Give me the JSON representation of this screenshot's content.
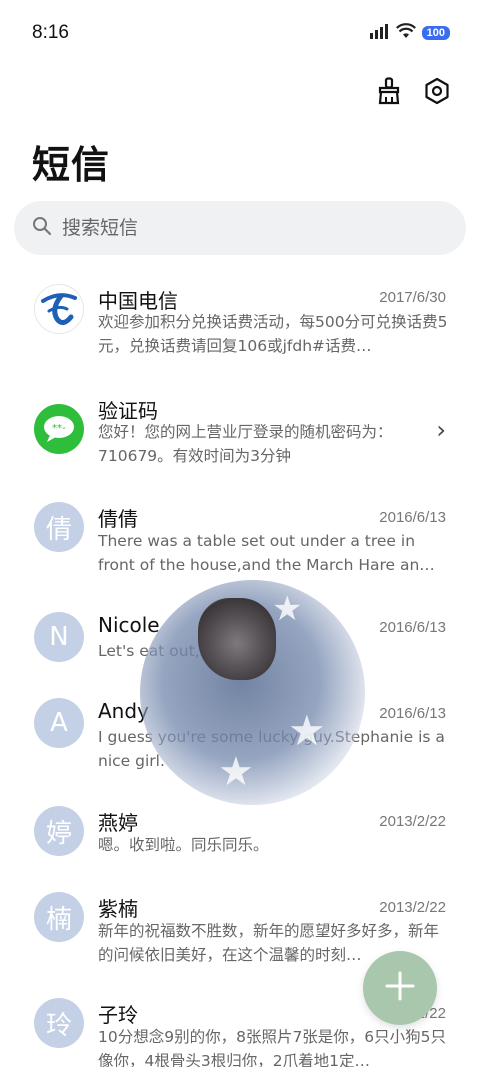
{
  "status_bar": {
    "time": "8:16",
    "battery": "100"
  },
  "header": {
    "title": "短信"
  },
  "search": {
    "placeholder": "搜索短信"
  },
  "messages": [
    {
      "name": "中国电信",
      "date": "2017/6/30",
      "preview": "欢迎参加积分兑换话费活动，每500分可兑换话费5元，兑换话费请回复106或jfdh#话费…",
      "avatar": "telecom-logo"
    },
    {
      "name": "验证码",
      "date": "",
      "preview": "您好！您的网上营业厅登录的随机密码为：710679。有效时间为3分钟",
      "avatar": "message-bubble-icon"
    },
    {
      "name": "倩倩",
      "date": "2016/6/13",
      "preview": "There was a table set out under a tree in front of the house,and the March Hare an…",
      "avatar_text": "倩"
    },
    {
      "name": "Nicole",
      "date": "2016/6/13",
      "preview": "Let's eat out,shall we?",
      "avatar_text": "N"
    },
    {
      "name": "Andy",
      "date": "2016/6/13",
      "preview": "I guess you're some lucky guy.Stephanie is a nice girl.",
      "avatar_text": "A"
    },
    {
      "name": "燕婷",
      "date": "2013/2/22",
      "preview": "嗯。收到啦。同乐同乐。",
      "avatar_text": "婷"
    },
    {
      "name": "紫楠",
      "date": "2013/2/22",
      "preview": "新年的祝福数不胜数，新年的愿望好多好多，新年的问候依旧美好，在这个温馨的时刻…",
      "avatar_text": "楠"
    },
    {
      "name": "子玲",
      "date": "2013/2/22",
      "preview": "10分想念9别的你，8张照片7张是你，6只小狗5只像你，4根骨头3根归你，2爪着地1定…",
      "avatar_text": "玲"
    }
  ],
  "colors": {
    "accent_green": "#a9c7ad",
    "avatar_bg": "#c3d0e6",
    "telecom_blue": "#1f5fb6",
    "chat_green": "#2fbd3c"
  }
}
